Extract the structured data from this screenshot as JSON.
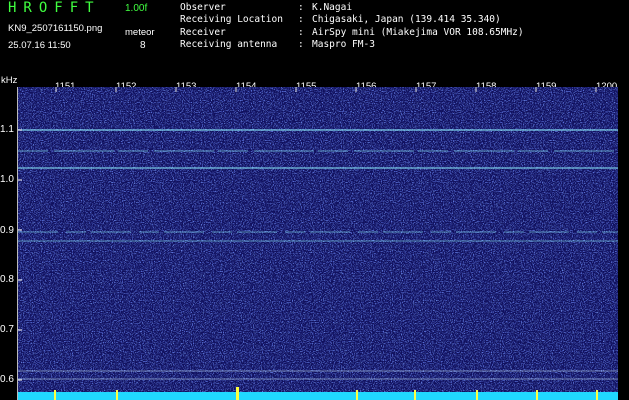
{
  "header": {
    "app_title": "HROFFT",
    "version": "1.00f",
    "filename": "KN9_2507161150.png",
    "timestamp": "25.07.16 11:50",
    "meteor_label": "meteor",
    "meteor_count": "8"
  },
  "info": [
    {
      "key": "Observer",
      "value": "K.Nagai"
    },
    {
      "key": "Receiving Location",
      "value": "Chigasaki, Japan (139.414 35.340)"
    },
    {
      "key": "Receiver",
      "value": "AirSpy mini (Miakejima VOR 108.65MHz)"
    },
    {
      "key": "Receiving antenna",
      "value": "Maspro FM-3"
    }
  ],
  "axis": {
    "y_unit": "kHz",
    "y_ticks": [
      "1.1",
      "1.0",
      "0.9",
      "0.8",
      "0.7",
      "0.6"
    ],
    "x_ticks": [
      "1151",
      "1152",
      "1153",
      "1154",
      "1155",
      "1156",
      "1157",
      "1158",
      "1159",
      "1200"
    ]
  },
  "colors": {
    "background": "#000000",
    "title": "#40ff40",
    "spectrogram_base": "#10105e",
    "carrier": "#8ff0ff",
    "bottom_band": "#20d8ff",
    "meteor_tick": "#ffff40"
  }
}
